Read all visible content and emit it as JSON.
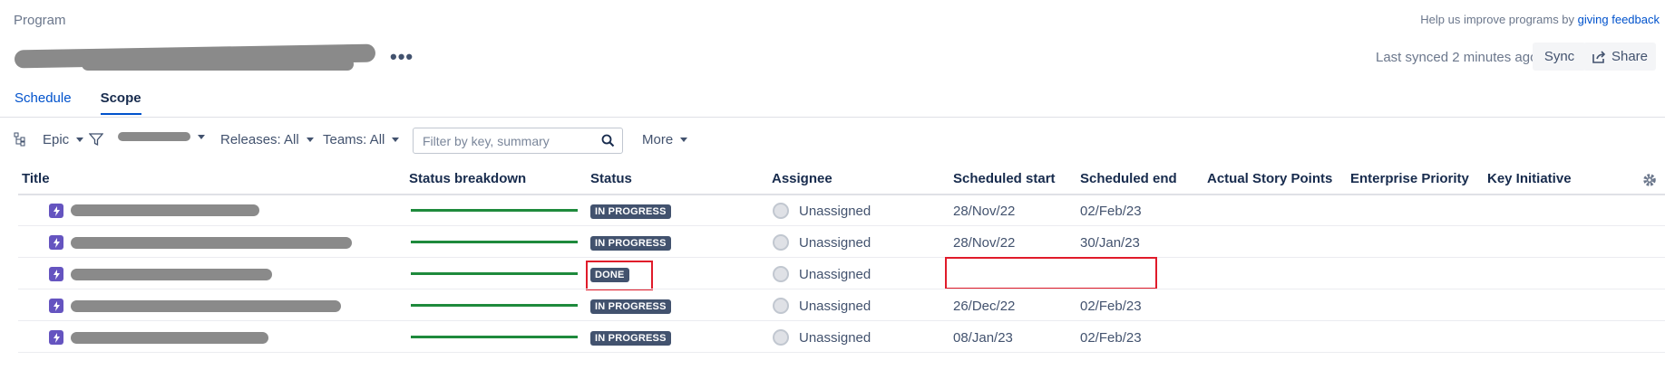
{
  "header": {
    "breadcrumb": "Program",
    "feedback_prefix": "Help us improve programs by ",
    "feedback_link": "giving feedback",
    "more_actions_icon": "more-horizontal-icon",
    "last_synced": "Last synced 2 minutes ago",
    "sync_label": "Sync",
    "share_label": "Share"
  },
  "tabs": [
    {
      "label": "Schedule",
      "active": false
    },
    {
      "label": "Scope",
      "active": true
    }
  ],
  "toolbar": {
    "hierarchy_icon": "hierarchy-icon",
    "issue_type": "Epic",
    "filter_icon": "filter-icon",
    "releases": "Releases: All",
    "teams": "Teams: All",
    "search_placeholder": "Filter by key, summary",
    "search_value": "",
    "more": "More"
  },
  "columns": [
    "Title",
    "Status breakdown",
    "Status",
    "Assignee",
    "Scheduled start",
    "Scheduled end",
    "Actual Story Points",
    "Enterprise Priority",
    "Key Initiative"
  ],
  "rows": [
    {
      "status": "IN PROGRESS",
      "assignee": "Unassigned",
      "start": "28/Nov/22",
      "end": "02/Feb/23",
      "progress": 1.0
    },
    {
      "status": "IN PROGRESS",
      "assignee": "Unassigned",
      "start": "28/Nov/22",
      "end": "30/Jan/23",
      "progress": 1.0
    },
    {
      "status": "DONE",
      "assignee": "Unassigned",
      "start": "",
      "end": "",
      "progress": 1.0
    },
    {
      "status": "IN PROGRESS",
      "assignee": "Unassigned",
      "start": "26/Dec/22",
      "end": "02/Feb/23",
      "progress": 1.0
    },
    {
      "status": "IN PROGRESS",
      "assignee": "Unassigned",
      "start": "08/Jan/23",
      "end": "02/Feb/23",
      "progress": 1.0
    }
  ],
  "colors": {
    "accent": "#0052cc",
    "status_lozenge": "#42526e",
    "progress_done": "#1e8a3c",
    "epic_icon": "#6554c0",
    "highlight": "#e01b2a"
  }
}
